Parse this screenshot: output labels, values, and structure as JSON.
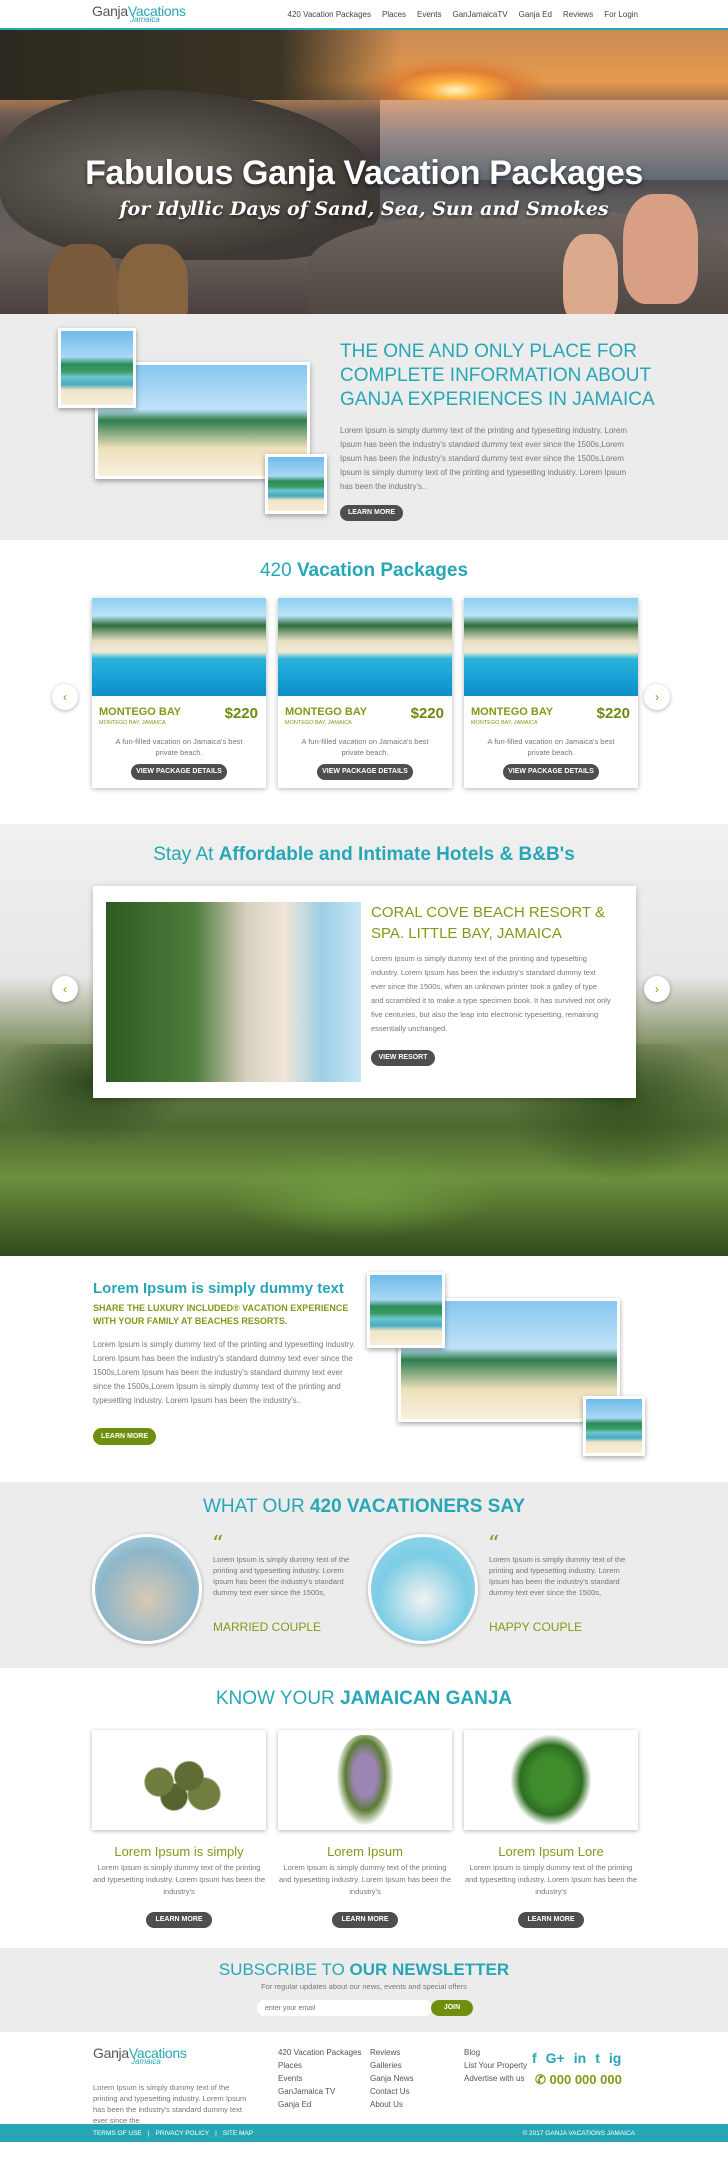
{
  "header": {
    "logo_main": "Ganja",
    "logo_accent": "Vacations",
    "logo_sub": "Jamaica",
    "nav": [
      "420 Vacation Packages",
      "Places",
      "Events",
      "GanJamaicaTV",
      "Ganja Ed",
      "Reviews",
      "For Login"
    ]
  },
  "hero": {
    "title": "Fabulous Ganja Vacation Packages",
    "subtitle": "for Idyllic Days of Sand, Sea, Sun and Smokes"
  },
  "intro": {
    "title": "THE ONE AND ONLY PLACE FOR COMPLETE INFORMATION ABOUT GANJA EXPERIENCES IN JAMAICA",
    "text": "Lorem Ipsum is simply dummy text of the printing and typesetting industry. Lorem Ipsum has been the industry's standard dummy text ever since the 1500s,Lorem Ipsum has been the industry's standard dummy text ever since the 1500s,Lorem Ipsum is simply dummy text of the printing and typesetting industry. Lorem Ipsum has been the industry's..",
    "button": "LEARN MORE"
  },
  "packages": {
    "title_plain": "420 ",
    "title_bold": "Vacation Packages",
    "cards": [
      {
        "name": "MONTEGO BAY",
        "sub": "MONTEGO BAY, JAMAICA",
        "price": "$220",
        "desc": "A fun-filled vacation on Jamaica's best private beach.",
        "button": "VIEW PACKAGE DETAILS"
      },
      {
        "name": "MONTEGO BAY",
        "sub": "MONTEGO BAY, JAMAICA",
        "price": "$220",
        "desc": "A fun-filled vacation on Jamaica's best private beach.",
        "button": "VIEW PACKAGE DETAILS"
      },
      {
        "name": "MONTEGO BAY",
        "sub": "MONTEGO BAY, JAMAICA",
        "price": "$220",
        "desc": "A fun-filled vacation on Jamaica's best private beach.",
        "button": "VIEW PACKAGE DETAILS"
      }
    ],
    "prev": "‹",
    "next": "›"
  },
  "hotels": {
    "title_plain": "Stay At ",
    "title_bold": "Affordable and Intimate Hotels & B&B's",
    "name": "CORAL COVE BEACH RESORT & SPA. LITTLE BAY, JAMAICA",
    "text": "Lorem Ipsum is simply dummy text of the printing and typesetting industry. Lorem Ipsum has been the industry's standard dummy text ever since the 1500s, when an unknown printer took a galley of type and scrambled it to make a type specimen book. It has survived not only five centuries, but also the leap into electronic typesetting, remaining essentially unchanged.",
    "button": "VIEW RESORT",
    "prev": "‹",
    "next": "›"
  },
  "luxury": {
    "title": "Lorem Ipsum is simply dummy text",
    "sub": "SHARE THE LUXURY INCLUDED® VACATION EXPERIENCE WITH YOUR FAMILY AT BEACHES RESORTS.",
    "text": "Lorem Ipsum is simply dummy text of the printing and typesetting industry. Lorem Ipsum has been the industry's standard dummy text ever since the 1500s,Lorem Ipsum has been the industry's standard dummy text ever since the 1500s,Lorem Ipsum is simply dummy text of the printing and typesetting industry. Lorem Ipsum has been the industry's..",
    "button": "LEARN MORE"
  },
  "testimonials": {
    "title_plain": "WHAT OUR ",
    "title_bold": "420 VACATIONERS SAY",
    "items": [
      {
        "text": "Lorem Ipsum is simply dummy text of the printing and typesetting industry. Lorem Ipsum has been the industry's standard dummy text ever since the 1500s,",
        "name": "MARRIED COUPLE"
      },
      {
        "text": "Lorem Ipsum is simply dummy text of the printing and typesetting industry. Lorem Ipsum has been the industry's standard dummy text ever since the 1500s,",
        "name": "HAPPY COUPLE"
      }
    ]
  },
  "ganja": {
    "title_plain": "KNOW YOUR ",
    "title_bold": "JAMAICAN GANJA",
    "items": [
      {
        "title": "Lorem Ipsum is simply",
        "text": "Lorem Ipsum is simply dummy text of the printing and typesetting industry. Lorem Ipsum has been the industry's",
        "button": "LEARN MORE"
      },
      {
        "title": "Lorem Ipsum",
        "text": "Lorem Ipsum is simply dummy text of the printing and typesetting industry. Lorem Ipsum has been the industry's",
        "button": "LEARN MORE"
      },
      {
        "title": "Lorem Ipsum Lore",
        "text": "Lorem Ipsum is simply dummy text of the printing and typesetting industry. Lorem Ipsum has been the industry's",
        "button": "LEARN MORE"
      }
    ]
  },
  "newsletter": {
    "title_plain": "SUBSCRIBE TO ",
    "title_bold": "OUR NEWSLETTER",
    "sub": "For regular updates about our news, events and special offers",
    "placeholder": "enter your email",
    "button": "JOIN"
  },
  "footer": {
    "text": "Lorem Ipsum is simply dummy text of the printing and typesetting industry. Lorem Ipsum has been the industry's standard dummy text ever since the",
    "col1": [
      "420 Vacation Packages",
      "Places",
      "Events",
      "GanJamaica TV",
      "Ganja Ed"
    ],
    "col2": [
      "Reviews",
      "Galleries",
      "Ganja News",
      "Contact Us",
      "About Us"
    ],
    "col3": [
      "Blog",
      "List Your Property",
      "Advertise with us"
    ],
    "social": [
      "f",
      "G+",
      "in",
      "t",
      "ig"
    ],
    "phone": "000 000 000",
    "bottom_links": [
      "TERMS OF USE",
      "|",
      "PRIVACY POLICY",
      "|",
      "SITE MAP"
    ],
    "copyright": "© 2017 GANJA VACATIONS JAMAICA"
  },
  "colors": {
    "teal": "#27a7b6",
    "green": "#7c9c18",
    "dark_button": "#4e4e4e"
  }
}
